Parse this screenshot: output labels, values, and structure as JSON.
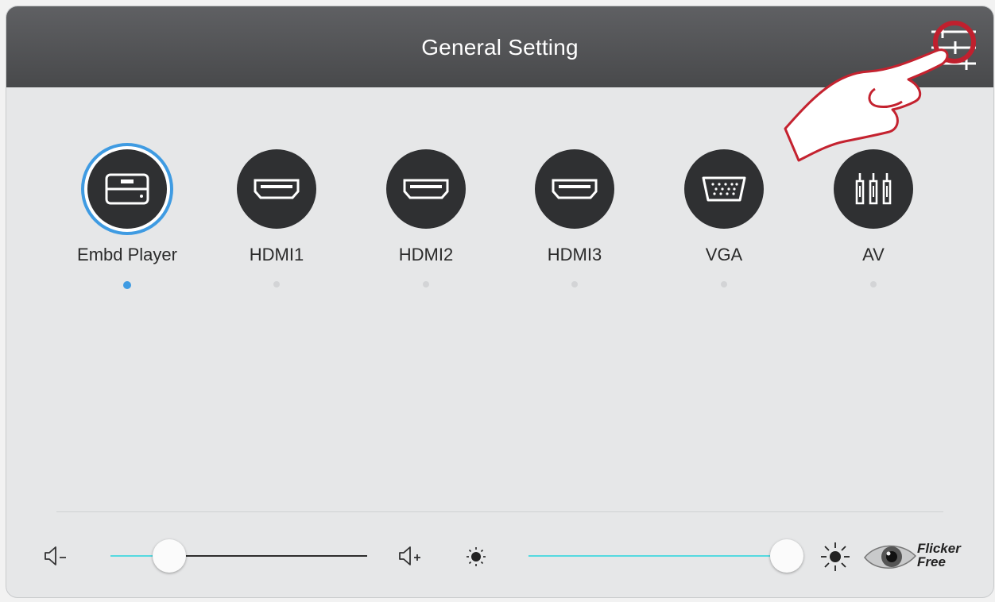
{
  "header": {
    "title": "General Setting",
    "settings_icon": "sliders-icon"
  },
  "sources": [
    {
      "label": "Embd Player",
      "icon": "media-player-icon",
      "active": true
    },
    {
      "label": "HDMI1",
      "icon": "hdmi-icon",
      "active": false
    },
    {
      "label": "HDMI2",
      "icon": "hdmi-icon",
      "active": false
    },
    {
      "label": "HDMI3",
      "icon": "hdmi-icon",
      "active": false
    },
    {
      "label": "VGA",
      "icon": "vga-icon",
      "active": false
    },
    {
      "label": "AV",
      "icon": "av-icon",
      "active": false
    }
  ],
  "controls": {
    "volume": {
      "value": 0.23,
      "down_icon": "volume-down-icon",
      "up_icon": "volume-up-icon"
    },
    "brightness": {
      "value": 1.0,
      "low_icon": "brightness-low-icon",
      "high_icon": "brightness-high-icon"
    },
    "flicker_free": {
      "line1": "Flicker",
      "line2": "Free"
    }
  },
  "colors": {
    "accent": "#3f9be2",
    "slider_fill": "#55d9e0",
    "header_bg": "#4f5052"
  }
}
